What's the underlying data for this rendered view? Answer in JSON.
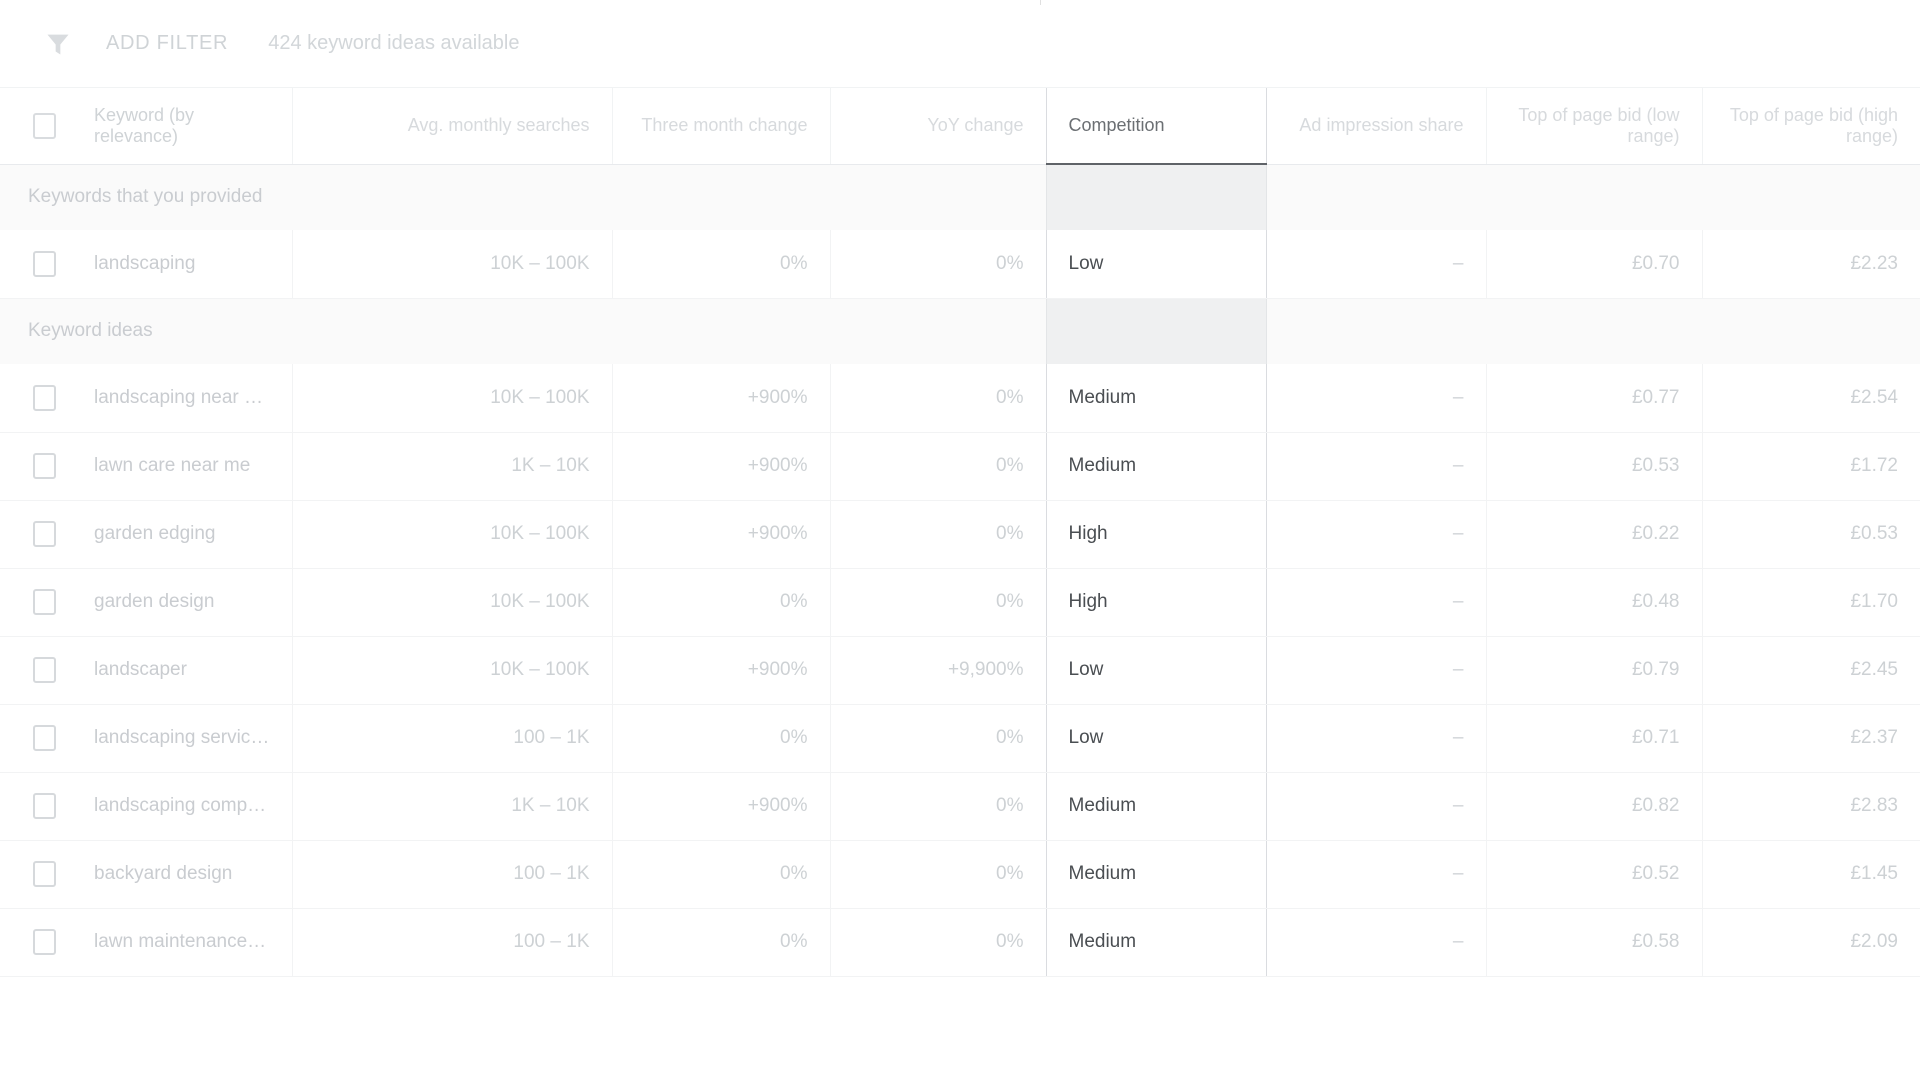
{
  "toolbar": {
    "filter_icon": "filter-icon",
    "add_filter_label": "ADD FILTER",
    "ideas_available": "424 keyword ideas available"
  },
  "table": {
    "columns": [
      {
        "key": "select",
        "label": ""
      },
      {
        "key": "keyword",
        "label": "Keyword (by relevance)"
      },
      {
        "key": "avg",
        "label": "Avg. monthly searches"
      },
      {
        "key": "three",
        "label": "Three month change"
      },
      {
        "key": "yoy",
        "label": "YoY change"
      },
      {
        "key": "comp",
        "label": "Competition"
      },
      {
        "key": "ais",
        "label": "Ad impression share"
      },
      {
        "key": "bidlow",
        "label": "Top of page bid (low range)"
      },
      {
        "key": "bidhigh",
        "label": "Top of page bid (high range)"
      }
    ],
    "active_column": "Competition",
    "groups": [
      {
        "title": "Keywords that you provided",
        "rows": [
          {
            "keyword": "landscaping",
            "avg": "10K – 100K",
            "three": "0%",
            "yoy": "0%",
            "comp": "Low",
            "ais": "–",
            "bidlow": "£0.70",
            "bidhigh": "£2.23"
          }
        ]
      },
      {
        "title": "Keyword ideas",
        "rows": [
          {
            "keyword": "landscaping near me",
            "avg": "10K – 100K",
            "three": "+900%",
            "yoy": "0%",
            "comp": "Medium",
            "ais": "–",
            "bidlow": "£0.77",
            "bidhigh": "£2.54"
          },
          {
            "keyword": "lawn care near me",
            "avg": "1K – 10K",
            "three": "+900%",
            "yoy": "0%",
            "comp": "Medium",
            "ais": "–",
            "bidlow": "£0.53",
            "bidhigh": "£1.72"
          },
          {
            "keyword": "garden edging",
            "avg": "10K – 100K",
            "three": "+900%",
            "yoy": "0%",
            "comp": "High",
            "ais": "–",
            "bidlow": "£0.22",
            "bidhigh": "£0.53"
          },
          {
            "keyword": "garden design",
            "avg": "10K – 100K",
            "three": "0%",
            "yoy": "0%",
            "comp": "High",
            "ais": "–",
            "bidlow": "£0.48",
            "bidhigh": "£1.70"
          },
          {
            "keyword": "landscaper",
            "avg": "10K – 100K",
            "three": "+900%",
            "yoy": "+9,900%",
            "comp": "Low",
            "ais": "–",
            "bidlow": "£0.79",
            "bidhigh": "£2.45"
          },
          {
            "keyword": "landscaping service…",
            "avg": "100 – 1K",
            "three": "0%",
            "yoy": "0%",
            "comp": "Low",
            "ais": "–",
            "bidlow": "£0.71",
            "bidhigh": "£2.37"
          },
          {
            "keyword": "landscaping compa…",
            "avg": "1K – 10K",
            "three": "+900%",
            "yoy": "0%",
            "comp": "Medium",
            "ais": "–",
            "bidlow": "£0.82",
            "bidhigh": "£2.83"
          },
          {
            "keyword": "backyard design",
            "avg": "100 – 1K",
            "three": "0%",
            "yoy": "0%",
            "comp": "Medium",
            "ais": "–",
            "bidlow": "£0.52",
            "bidhigh": "£1.45"
          },
          {
            "keyword": "lawn maintenance …",
            "avg": "100 – 1K",
            "three": "0%",
            "yoy": "0%",
            "comp": "Medium",
            "ais": "–",
            "bidlow": "£0.58",
            "bidhigh": "£2.09"
          }
        ]
      }
    ]
  },
  "colors": {
    "muted_text": "#cdd1d4",
    "active_text": "#4a4e52",
    "group_band": "#fafafa",
    "group_band_active": "#eff0f1",
    "border": "#f2f3f4",
    "active_border": "#dadce0"
  }
}
